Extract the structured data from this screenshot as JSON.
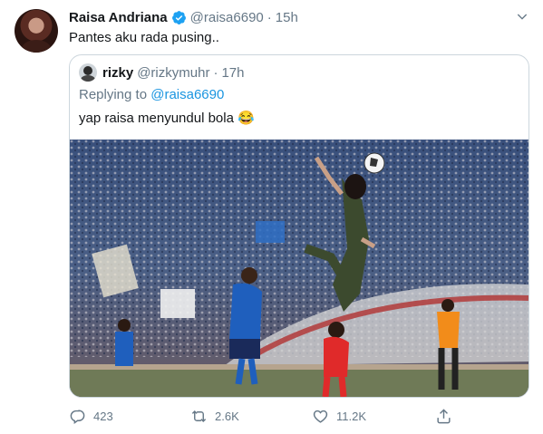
{
  "author": {
    "name": "Raisa Andriana",
    "handle": "@raisa6690",
    "separator": "·",
    "time": "15h",
    "text": "Pantes aku rada pusing.."
  },
  "quoted": {
    "name": "rizky",
    "handle": "@rizkymuhr",
    "separator": "·",
    "time": "17h",
    "replying_prefix": "Replying to ",
    "replying_handle": "@raisa6690",
    "text": "yap raisa menyundul bola 😂"
  },
  "actions": {
    "replies": "423",
    "retweets": "2.6K",
    "likes": "11.2K"
  },
  "colors": {
    "verified": "#1da1f2",
    "link": "#1b95e0",
    "secondary": "#657786",
    "border": "#ccd6dd"
  },
  "icons": {
    "verified": "verified-badge-icon",
    "caret": "chevron-down-icon",
    "reply": "reply-icon",
    "retweet": "retweet-icon",
    "like": "heart-icon",
    "share": "share-icon"
  }
}
